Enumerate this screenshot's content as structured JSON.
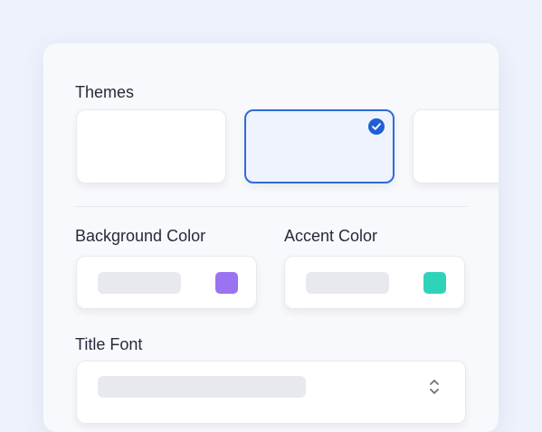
{
  "themes": {
    "label": "Themes",
    "selected_index": 1,
    "options": [
      {
        "selected": false
      },
      {
        "selected": true
      },
      {
        "selected": false
      }
    ]
  },
  "background_color": {
    "label": "Background Color",
    "swatch": "#9b72f0"
  },
  "accent_color": {
    "label": "Accent Color",
    "swatch": "#2fd3b7"
  },
  "title_font": {
    "label": "Title Font",
    "icon": "chevron-up-down-icon"
  },
  "colors": {
    "page_background": "#eef2fc",
    "panel": "#f8f9fc",
    "selected_border": "#2f6bd9",
    "check_fill": "#1f5fd6",
    "placeholder": "#e8e9ee"
  }
}
